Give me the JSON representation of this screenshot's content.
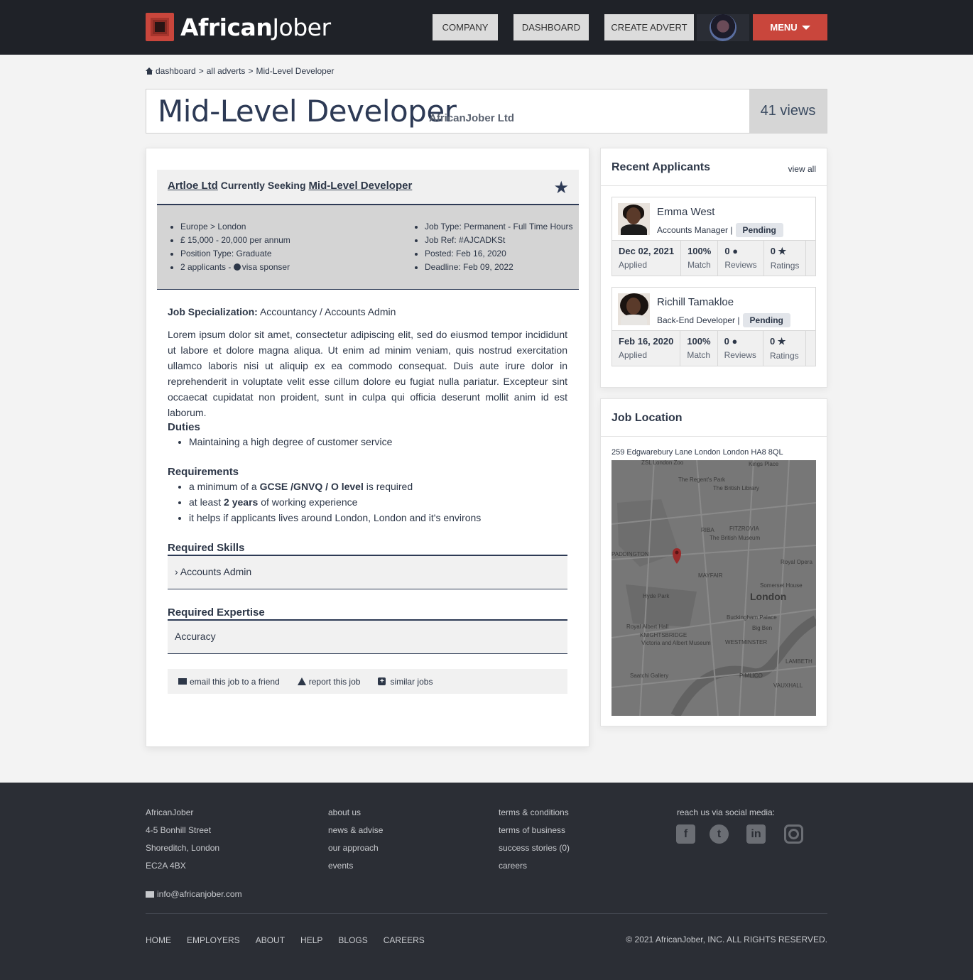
{
  "header": {
    "logo_bold": "African",
    "logo_light": "Jober",
    "nav": [
      "COMPANY",
      "DASHBOARD",
      "CREATE ADVERT"
    ],
    "menu_label": "MENU"
  },
  "breadcrumb": [
    "dashboard",
    ">",
    "all adverts",
    ">",
    "Mid-Level Developer"
  ],
  "title": {
    "job": "Mid-Level Developer",
    "company": "AfricanJober Ltd",
    "views": "41 views"
  },
  "job": {
    "seek_company": "Artloe Ltd",
    "seek_middle": "Currently Seeking",
    "seek_role": "Mid-Level Developer",
    "info_left": [
      "Europe > London",
      "£ 15,000 - 20,000 per annum",
      "Position Type: Graduate"
    ],
    "applicants_text": "2 applicants - ",
    "visa_text": "visa sponser",
    "info_right": [
      "Job Type: Permanent - Full Time Hours",
      "Job Ref: #AJCADKSt",
      "Posted: Feb 16, 2020",
      "Deadline: Feb 09, 2022"
    ],
    "spec_label": "Job Specialization:",
    "spec_value": "Accountancy / Accounts Admin",
    "description": "Lorem ipsum dolor sit amet, consectetur adipiscing elit, sed do eiusmod tempor incididunt ut labore et dolore magna aliqua. Ut enim ad minim veniam, quis nostrud exercitation ullamco laboris nisi ut aliquip ex ea commodo consequat. Duis aute irure dolor in reprehenderit in voluptate velit esse cillum dolore eu fugiat nulla pariatur. Excepteur sint occaecat cupidatat non proident, sunt in culpa qui officia deserunt mollit anim id est laborum.",
    "duties_h": "Duties",
    "duties": [
      "Maintaining a high degree of customer service"
    ],
    "requirements_h": "Requirements",
    "req1_a": "a minimum of a ",
    "req1_b": "GCSE /GNVQ / O level",
    "req1_c": " is required",
    "req2_a": "at least ",
    "req2_b": "2 years",
    "req2_c": " of working experience",
    "req3": "it helps if applicants lives around London, London and it's environs",
    "skills_h": "Required Skills",
    "skill": "Accounts Admin",
    "expertise_h": "Required Expertise",
    "expertise": "Accuracy",
    "actions": [
      "email this job to a friend",
      "report this job",
      "similar jobs"
    ]
  },
  "applicants": {
    "title": "Recent Applicants",
    "view_all": "view all",
    "list": [
      {
        "name": "Emma West",
        "role": "Accounts Manager |",
        "status": "Pending",
        "date": "Dec 02, 2021",
        "date_label": "Applied",
        "match": "100%",
        "match_label": "Match",
        "reviews": "0",
        "reviews_label": "Reviews",
        "ratings": "0",
        "ratings_label": "Ratings"
      },
      {
        "name": "Richill Tamakloe",
        "role": "Back-End Developer |",
        "status": "Pending",
        "date": "Feb 16, 2020",
        "date_label": "Applied",
        "match": "100%",
        "match_label": "Match",
        "reviews": "0",
        "reviews_label": "Reviews",
        "ratings": "0",
        "ratings_label": "Ratings"
      }
    ]
  },
  "location": {
    "title": "Job Location",
    "address": "259 Edgwarebury Lane London London HA8 8QL",
    "map_labels": [
      "ZSL London Zoo",
      "Kings Place",
      "The Regent's Park",
      "The British Library",
      "RIBA",
      "FITZROVIA",
      "The British Museum",
      "PADDINGTON",
      "MAYFAIR",
      "Royal Opera",
      "Somerset House",
      "London",
      "Hyde Park",
      "Buckingham Palace",
      "Big Ben",
      "Royal Albert Hall",
      "KNIGHTSBRIDGE",
      "Victoria and Albert Museum",
      "WESTMINSTER",
      "LAMBETH",
      "Saatchi Gallery",
      "PIMLICO",
      "VAUXHALL"
    ]
  },
  "footer": {
    "col1": [
      "AfricanJober",
      "4-5 Bonhill Street",
      "Shoreditch, London",
      "EC2A 4BX"
    ],
    "col2": [
      "about us",
      "news & advise",
      "our approach",
      "events"
    ],
    "col3": [
      "terms & conditions",
      "terms of business",
      "success stories (0)",
      "careers"
    ],
    "social_label": "reach us via social media:",
    "email": "info@africanjober.com",
    "nav": [
      "HOME",
      "EMPLOYERS",
      "ABOUT",
      "HELP",
      "BLOGS",
      "CAREERS"
    ],
    "copyright": "© 2021 AfricanJober, INC. ALL RIGHTS RESERVED."
  }
}
